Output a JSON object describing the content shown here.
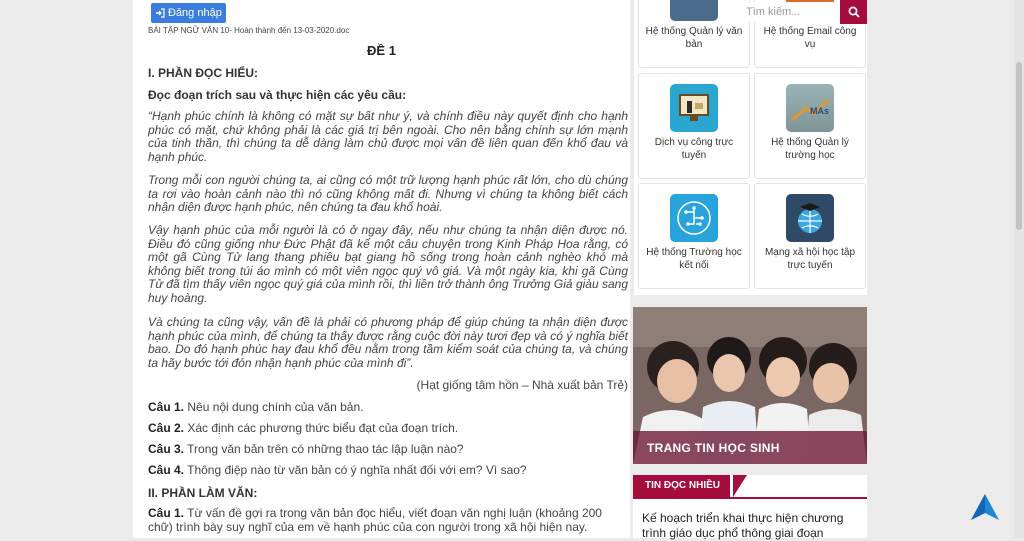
{
  "header": {
    "login_label": "Đăng nhập",
    "search_placeholder": "Tìm kiếm..."
  },
  "document": {
    "filename": "BÀI TẬP NGỮ VĂN 10- Hoàn thành đến 13-03-2020.doc",
    "heading": "ĐỀ 1",
    "section1": "I. PHẦN ĐỌC HIỂU:",
    "instruction": "Đọc đoạn trích sau và thực hiện các yêu cầu:",
    "paragraphs": [
      "“Hạnh phúc chính là không có mặt sự bất như ý, và chính điều này quyết định cho hạnh phúc có mặt, chứ không phải là các giá trị bên ngoài. Cho nên bằng chính sự lớn mạnh của tinh thần, thì chúng ta dễ dàng làm chủ được mọi vấn đề liên quan đến khổ đau và hạnh phúc.",
      "Trong mỗi con người chúng ta, ai cũng có một trữ lượng hạnh phúc rất lớn, cho dù chúng ta rơi vào hoàn cảnh nào thì nó cũng không mất đi. Nhưng vì chúng ta không biết cách nhận diện được hạnh phúc, nên chúng ta đau khổ hoài.",
      "Vậy hạnh phúc của mỗi người là có ở ngay đây, nếu như chúng ta nhận diện được nó. Điều đó cũng giống như Đức Phật đã kể một câu chuyện trong Kinh Pháp Hoa rằng, có một gã Cùng Tử lang thang phiêu bạt giang hồ sống trong hoàn cảnh nghèo khó mà không biết trong túi áo mình có một viên ngọc quý vô giá. Và một ngày kia, khi gã Cùng Tử đã tìm thấy viên ngọc quý giá của mình rồi, thì liền trở thành ông Trưởng Giả giàu sang huy hoàng.",
      "Và chúng ta cũng vậy, vấn đề là phải có phương pháp để giúp chúng ta nhận diện được hạnh phúc của mình, để chúng ta thấy được rằng cuộc đời này tươi đẹp và có ý nghĩa biết bao. Do đó hạnh phúc hay đau khổ đều nằm trong tầm kiểm soát của chúng ta, và chúng ta hãy bước tới đón nhận hạnh phúc của mình đi”."
    ],
    "source": "(Hạt giống tâm hồn – Nhà xuất bản Trẻ)",
    "questions": [
      {
        "label": "Câu 1.",
        "text": " Nêu nội dung chính của văn bản."
      },
      {
        "label": "Câu 2.",
        "text": " Xác định các phương thức biểu đạt của đoạn trích."
      },
      {
        "label": "Câu 3.",
        "text": " Trong văn bản trên có những thao tác lập luận nào?"
      },
      {
        "label": "Câu 4.",
        "text": " Thông điệp nào từ văn bản có ý nghĩa nhất đối với em? Vì sao?"
      }
    ],
    "section2": "II. PHẦN LÀM VĂN:",
    "essay": {
      "label": "Câu 1.",
      "text": " Từ vấn đề gợi ra trong văn bản đọc hiểu, viết đoạn văn nghị luận (khoảng 200 chữ) trình bày suy nghĩ của em về hạnh phúc của con người trong xã hội hiện nay."
    }
  },
  "sidebar": {
    "tiles": [
      {
        "label": "Hệ thống Quản lý văn bản",
        "icon": "document-management-icon"
      },
      {
        "label": "Hệ thống Email công vụ",
        "icon": "email-icon"
      },
      {
        "label": "Dịch vụ công trực tuyến",
        "icon": "public-service-icon",
        "color": "#2ba6d0"
      },
      {
        "label": "Hệ thống Quản lý trường học",
        "icon": "school-management-icon",
        "color": "#8aa3a6"
      },
      {
        "label": "Hệ thống Trường học kết nối",
        "icon": "circuit-icon",
        "color": "#29a3dc"
      },
      {
        "label": "Mạng xã hội học tập trực tuyến",
        "icon": "globe-graduation-icon",
        "color": "#2e4a66"
      }
    ],
    "tile_brand_text": "MAs",
    "banner_caption": "TRANG TIN HỌC SINH",
    "news_tab": "TIN ĐỌC NHIỀU",
    "news_items": [
      "Kế hoạch triển khai thực hiện chương trình giáo dục phổ thông giai đoạn"
    ]
  },
  "colors": {
    "brand": "#a50d3d",
    "login": "#3b7ddd"
  }
}
